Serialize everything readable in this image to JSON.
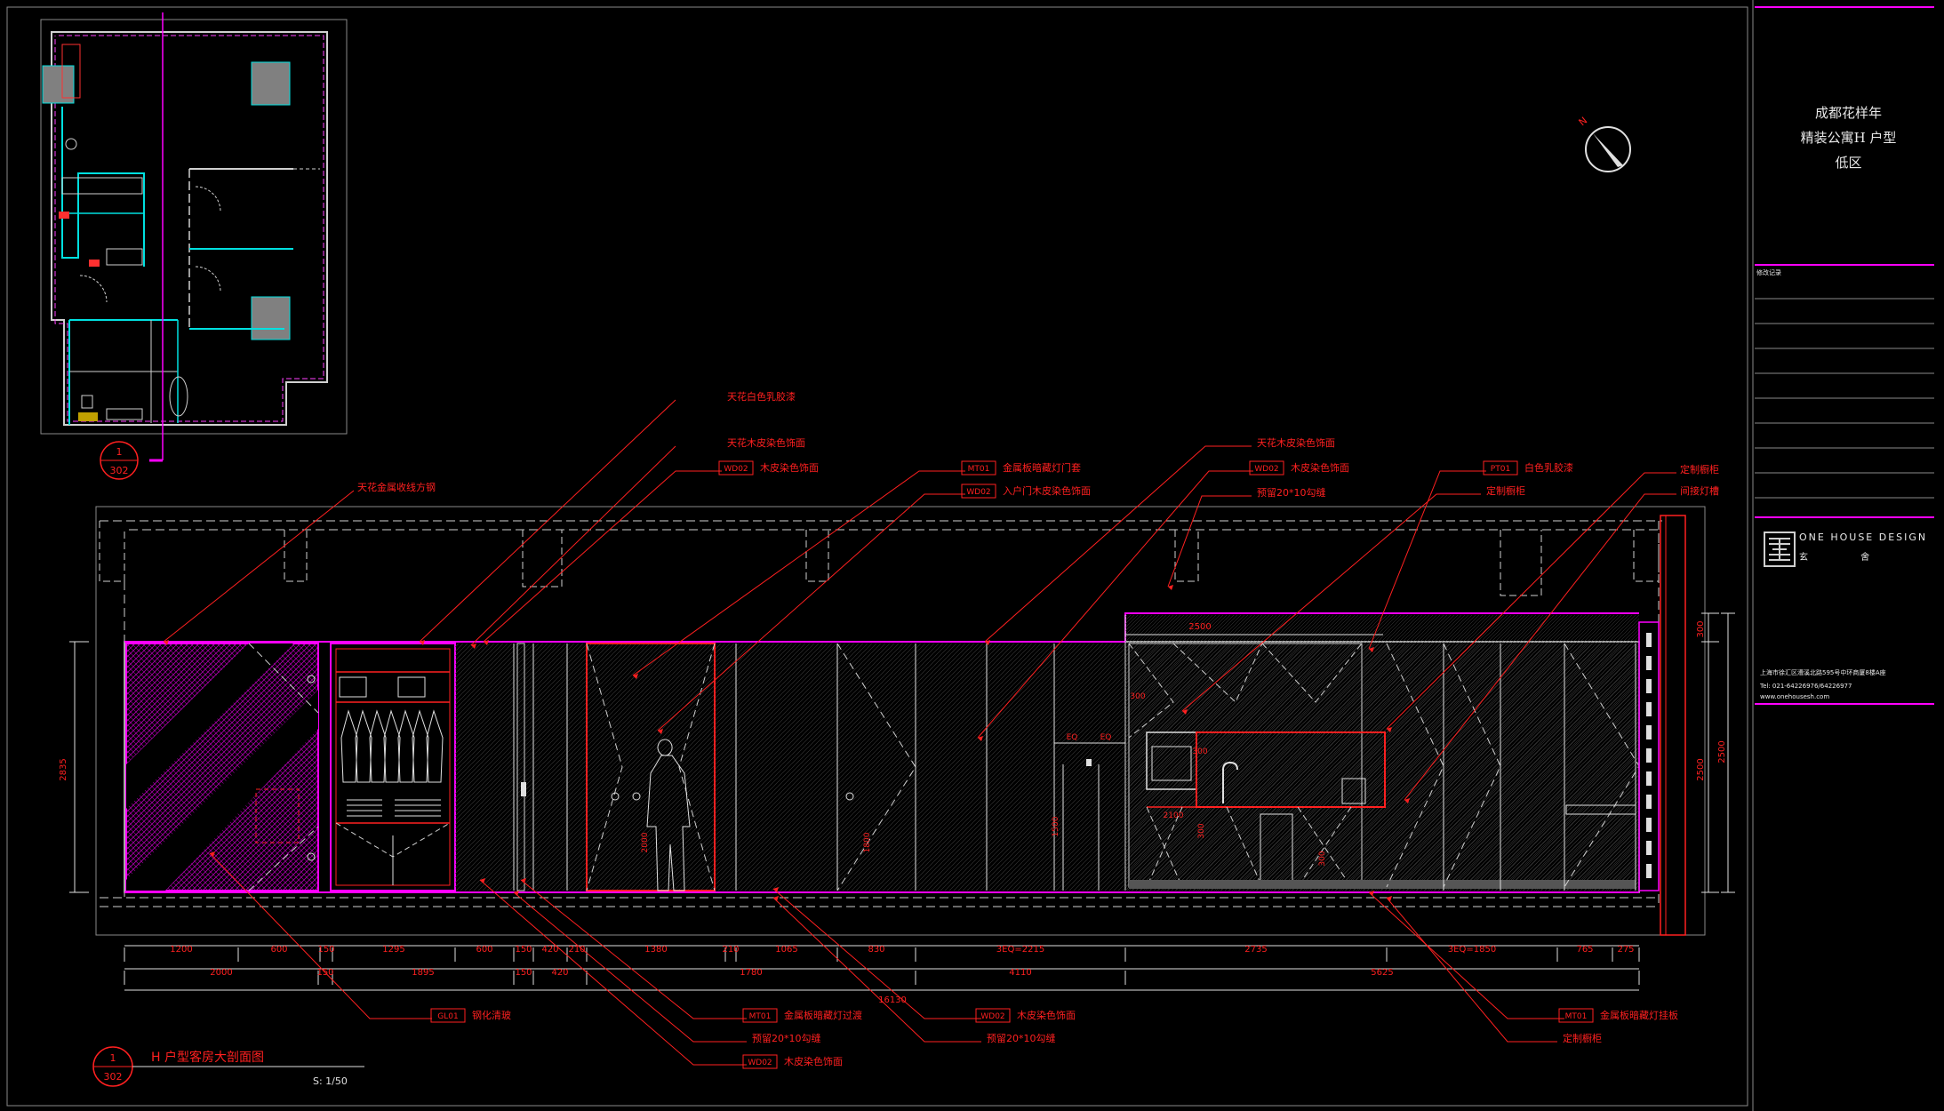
{
  "title_block": {
    "project_line1": "成都花样年",
    "project_line2": "精装公寓H 户型",
    "project_line3": "低区",
    "drawing_no_label": "修改记录",
    "company_en": "ONE HOUSE DESIGN",
    "company_cn": "玄 舍",
    "address": "上海市徐汇区漕溪北路595号中环商厦8楼A座",
    "tel": "Tel: 021-64226976/64226977",
    "website": "www.onehousesh.com"
  },
  "key_plan": {
    "callout_top": "1",
    "callout_bottom": "302"
  },
  "drawing": {
    "title": "H 户型客房大剖面图",
    "scale": "S: 1/50",
    "callout_top": "1",
    "callout_bottom": "302"
  },
  "annotations": [
    {
      "text": "天花金属收线方钢",
      "code": ""
    },
    {
      "text": "天花白色乳胶漆",
      "code": ""
    },
    {
      "text": "天花木皮染色饰面",
      "code": ""
    },
    {
      "text": "木皮染色饰面",
      "code": "WD02"
    },
    {
      "text": "金属板暗藏灯门套",
      "code": "MT01"
    },
    {
      "text": "入户门木皮染色饰面",
      "code": "WD02"
    },
    {
      "text": "天花木皮染色饰面",
      "code": ""
    },
    {
      "text": "木皮染色饰面",
      "code": "WD02"
    },
    {
      "text": "预留20*10勾缝",
      "code": ""
    },
    {
      "text": "白色乳胶漆",
      "code": "PT01"
    },
    {
      "text": "定制橱柜",
      "code": ""
    },
    {
      "text": "定制橱柜",
      "code": ""
    },
    {
      "text": "间接灯槽",
      "code": ""
    },
    {
      "text": "钢化清玻",
      "code": "GL01"
    },
    {
      "text": "金属板暗藏灯过渡",
      "code": "MT01"
    },
    {
      "text": "预留20*10勾缝",
      "code": ""
    },
    {
      "text": "木皮染色饰面",
      "code": "WD02"
    },
    {
      "text": "木皮染色饰面",
      "code": "WD02"
    },
    {
      "text": "预留20*10勾缝",
      "code": ""
    },
    {
      "text": "金属板暗藏灯挂板",
      "code": "MT01"
    },
    {
      "text": "定制橱柜",
      "code": ""
    }
  ],
  "dimensions": {
    "row1": [
      "1200",
      "600",
      "150",
      "1295",
      "600",
      "150",
      "420",
      "210",
      "1380",
      "210",
      "1065",
      "830",
      "3EQ=2215",
      "2735",
      "3EQ=1850",
      "765",
      "275"
    ],
    "row2": [
      "2000",
      "150",
      "1895",
      "150",
      "420",
      "1780",
      "4110",
      "5625"
    ],
    "total": "16130",
    "left_height": "2835",
    "right_top": "300",
    "right_height": "2500",
    "kitchen_width": "2500",
    "misc": [
      "EQ",
      "EQ",
      "300",
      "1500",
      "2000",
      "1800",
      "300",
      "2100",
      "300",
      "300"
    ]
  },
  "compass": {
    "north": "N"
  },
  "colors": {
    "background": "#000000",
    "red": "#ff2020",
    "magenta": "#ff00ff",
    "cyan": "#00e0e0",
    "white": "#e8e8e8",
    "gray": "#8a8a8a"
  }
}
